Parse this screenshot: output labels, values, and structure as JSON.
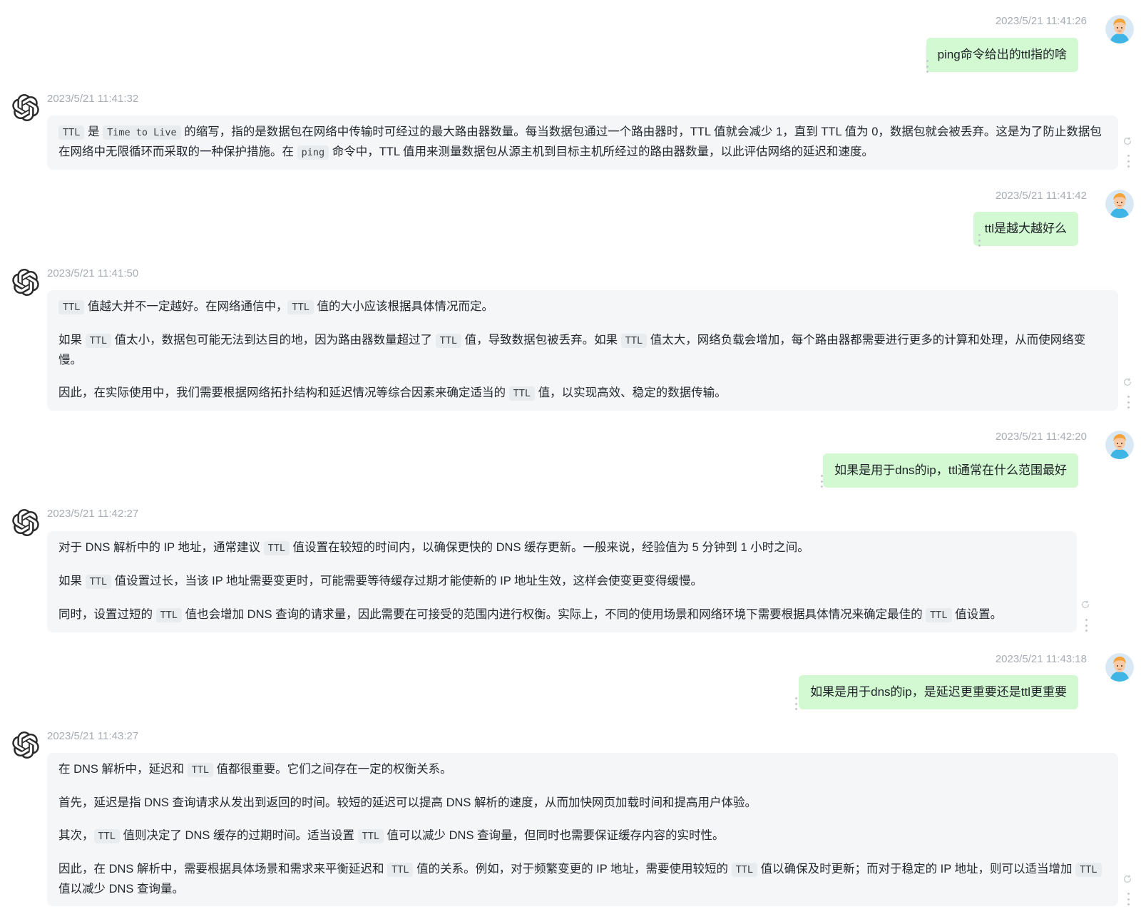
{
  "colors": {
    "user_bubble": "#d2f9d1",
    "bot_bubble": "#f4f6f8",
    "timestamp": "#a7adb4",
    "inline_code_bg": "#e9ecef"
  },
  "icons": {
    "user_avatar": "user-avatar-icon",
    "bot_avatar": "openai-logo-icon",
    "more": "more-vertical-icon",
    "regenerate": "refresh-icon"
  },
  "messages": [
    {
      "role": "user",
      "time": "2023/5/21 11:41:26",
      "text": "ping命令给出的ttl指的啥"
    },
    {
      "role": "bot",
      "time": "2023/5/21 11:41:32",
      "p1": {
        "c1": "TTL",
        "t1": " 是 ",
        "c2": "Time to Live",
        "t2": " 的缩写，指的是数据包在网络中传输时可经过的最大路由器数量。每当数据包通过一个路由器时，TTL 值就会减少 1，直到 TTL 值为 0，数据包就会被丢弃。这是为了防止数据包在网络中无限循环而采取的一种保护措施。在 ",
        "c3": "ping",
        "t3": " 命令中，TTL 值用来测量数据包从源主机到目标主机所经过的路由器数量，以此评估网络的延迟和速度。"
      }
    },
    {
      "role": "user",
      "time": "2023/5/21 11:41:42",
      "text": "ttl是越大越好么"
    },
    {
      "role": "bot",
      "time": "2023/5/21 11:41:50",
      "p1": {
        "c1": "TTL",
        "t1": " 值越大并不一定越好。在网络通信中，",
        "c2": "TTL",
        "t2": " 值的大小应该根据具体情况而定。"
      },
      "p2": {
        "t0": "如果 ",
        "c1": "TTL",
        "t1": " 值太小，数据包可能无法到达目的地，因为路由器数量超过了 ",
        "c2": "TTL",
        "t2": " 值，导致数据包被丢弃。如果 ",
        "c3": "TTL",
        "t3": " 值太大，网络负载会增加，每个路由器都需要进行更多的计算和处理，从而使网络变慢。"
      },
      "p3": {
        "t0": "因此，在实际使用中，我们需要根据网络拓扑结构和延迟情况等综合因素来确定适当的 ",
        "c1": "TTL",
        "t1": " 值，以实现高效、稳定的数据传输。"
      }
    },
    {
      "role": "user",
      "time": "2023/5/21 11:42:20",
      "text": "如果是用于dns的ip，ttl通常在什么范围最好"
    },
    {
      "role": "bot",
      "time": "2023/5/21 11:42:27",
      "p1": {
        "t0": "对于 DNS 解析中的 IP 地址，通常建议 ",
        "c1": "TTL",
        "t1": " 值设置在较短的时间内，以确保更快的 DNS 缓存更新。一般来说，经验值为 5 分钟到 1 小时之间。"
      },
      "p2": {
        "t0": "如果 ",
        "c1": "TTL",
        "t1": " 值设置过长，当该 IP 地址需要变更时，可能需要等待缓存过期才能使新的 IP 地址生效，这样会使变更变得缓慢。"
      },
      "p3": {
        "t0": "同时，设置过短的 ",
        "c1": "TTL",
        "t1": " 值也会增加 DNS 查询的请求量，因此需要在可接受的范围内进行权衡。实际上，不同的使用场景和网络环境下需要根据具体情况来确定最佳的 ",
        "c2": "TTL",
        "t2": " 值设置。"
      }
    },
    {
      "role": "user",
      "time": "2023/5/21 11:43:18",
      "text": "如果是用于dns的ip，是延迟更重要还是ttl更重要"
    },
    {
      "role": "bot",
      "time": "2023/5/21 11:43:27",
      "p1": {
        "t0": "在 DNS 解析中，延迟和 ",
        "c1": "TTL",
        "t1": " 值都很重要。它们之间存在一定的权衡关系。"
      },
      "p2": {
        "t0": "首先，延迟是指 DNS 查询请求从发出到返回的时间。较短的延迟可以提高 DNS 解析的速度，从而加快网页加载时间和提高用户体验。"
      },
      "p3": {
        "t0": "其次，",
        "c1": "TTL",
        "t1": " 值则决定了 DNS 缓存的过期时间。适当设置 ",
        "c2": "TTL",
        "t2": " 值可以减少 DNS 查询量，但同时也需要保证缓存内容的实时性。"
      },
      "p4": {
        "t0": "因此，在 DNS 解析中，需要根据具体场景和需求来平衡延迟和 ",
        "c1": "TTL",
        "t1": " 值的关系。例如，对于频繁变更的 IP 地址，需要使用较短的 ",
        "c2": "TTL",
        "t2": " 值以确保及时更新；而对于稳定的 IP 地址，则可以适当增加 ",
        "c3": "TTL",
        "t3": " 值以减少 DNS 查询量。"
      }
    }
  ]
}
